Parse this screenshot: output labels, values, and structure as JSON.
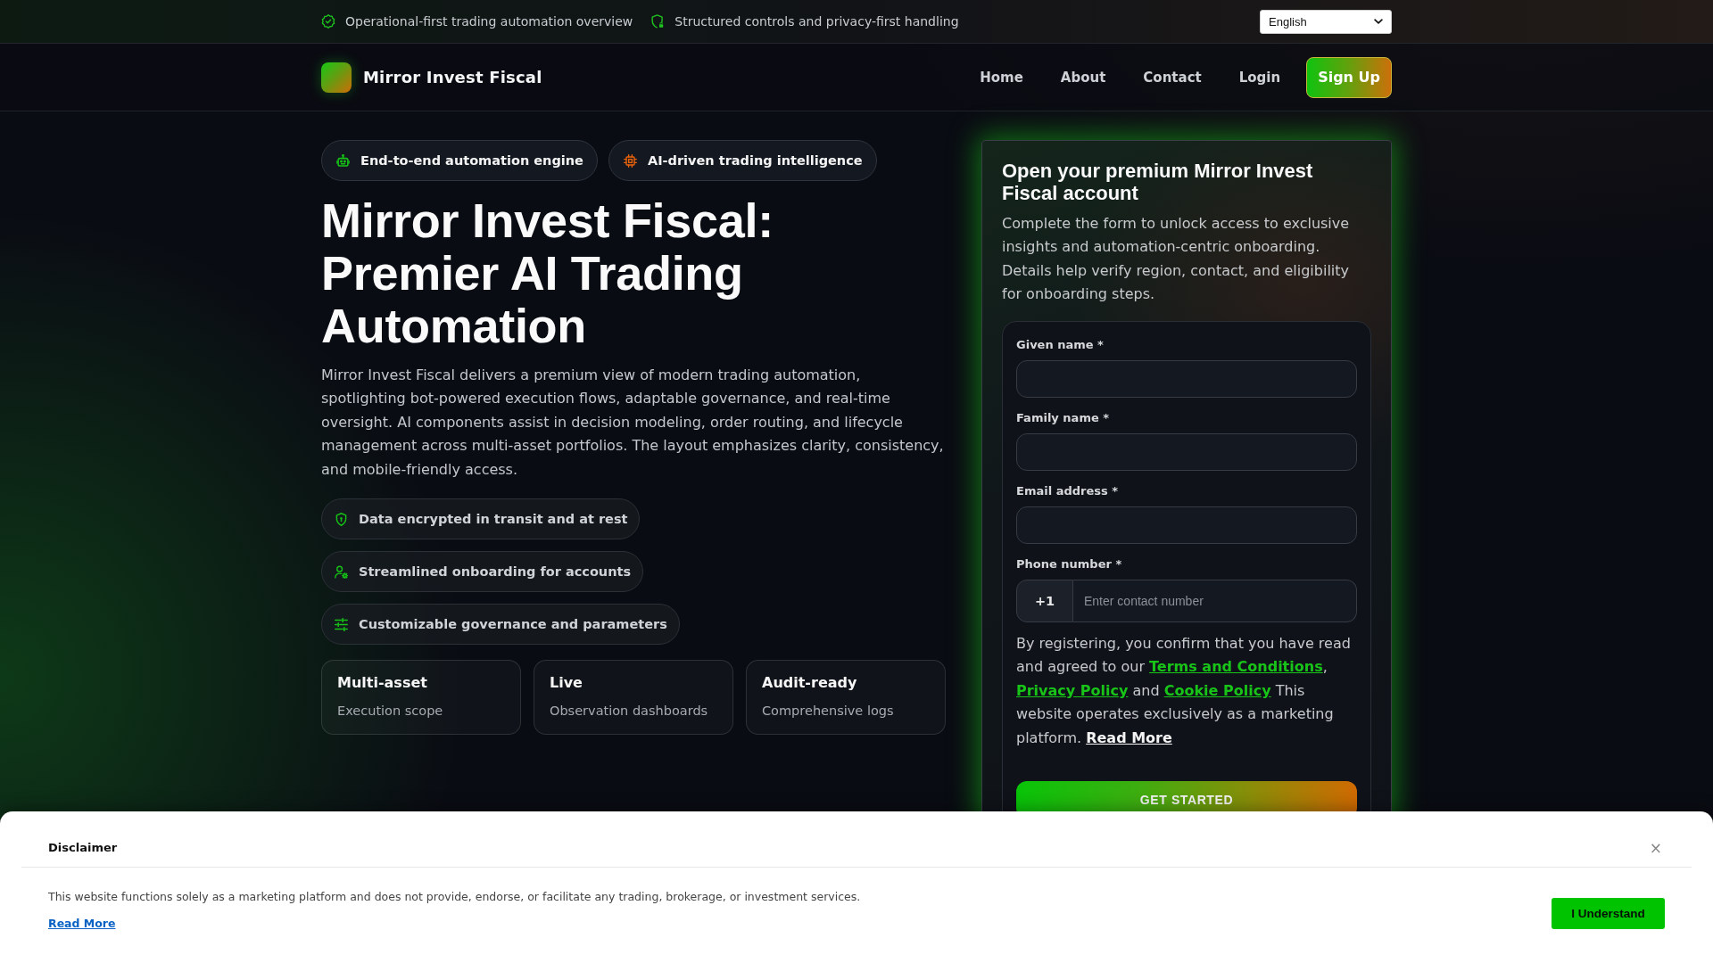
{
  "top_bar": {
    "items": [
      "Operational-first trading automation overview",
      "Structured controls and privacy-first handling"
    ],
    "language": {
      "value": "English"
    }
  },
  "nav": {
    "brand": "Mirror Invest Fiscal",
    "links": [
      "Home",
      "About",
      "Contact",
      "Login"
    ],
    "cta": "Sign Up"
  },
  "hero": {
    "badges": [
      "End-to-end automation engine",
      "AI-driven trading intelligence"
    ],
    "title": "Mirror Invest Fiscal: Premier AI Trading Automation",
    "description": "Mirror Invest Fiscal delivers a premium view of modern trading automation, spotlighting bot-powered execution flows, adaptable governance, and real-time oversight. AI components assist in decision modeling, order routing, and lifecycle management across multi-asset portfolios. The layout emphasizes clarity, consistency, and mobile-friendly access.",
    "features": [
      "Data encrypted in transit and at rest",
      "Streamlined onboarding for accounts",
      "Customizable governance and parameters"
    ],
    "stats": [
      {
        "title": "Multi-asset",
        "subtitle": "Execution scope"
      },
      {
        "title": "Live",
        "subtitle": "Observation dashboards"
      },
      {
        "title": "Audit-ready",
        "subtitle": "Comprehensive logs"
      }
    ]
  },
  "signup_form": {
    "title": "Open your premium Mirror Invest Fiscal account",
    "description": "Complete the form to unlock access to exclusive insights and automation-centric onboarding. Details help verify region, contact, and eligibility for onboarding steps.",
    "fields": [
      {
        "kind": "text",
        "label": "Given name *"
      },
      {
        "kind": "text",
        "label": "Family name *"
      },
      {
        "kind": "text",
        "label": "Email address *"
      },
      {
        "kind": "phone",
        "label": "Phone number *",
        "prefix": "+1",
        "placeholder": "Enter contact number"
      }
    ],
    "consent": [
      {
        "kind": "text",
        "text": "By registering, you confirm that you have read and agreed to our "
      },
      {
        "kind": "link",
        "text": "Terms and Conditions"
      },
      {
        "kind": "text",
        "text": ", "
      },
      {
        "kind": "link",
        "text": "Privacy Policy"
      },
      {
        "kind": "text",
        "text": " and "
      },
      {
        "kind": "link",
        "text": "Cookie Policy"
      },
      {
        "kind": "text",
        "text": " This website operates exclusively as a marketing platform. "
      },
      {
        "kind": "more",
        "text": "Read More"
      }
    ],
    "submit": "GET STARTED"
  },
  "disclaimer": {
    "title": "Disclaimer",
    "close": "×",
    "text": "This website functions solely as a marketing platform and does not provide, endorse, or facilitate any trading, brokerage, or investment services.",
    "read_more": "Read More",
    "accept": "I Understand"
  }
}
